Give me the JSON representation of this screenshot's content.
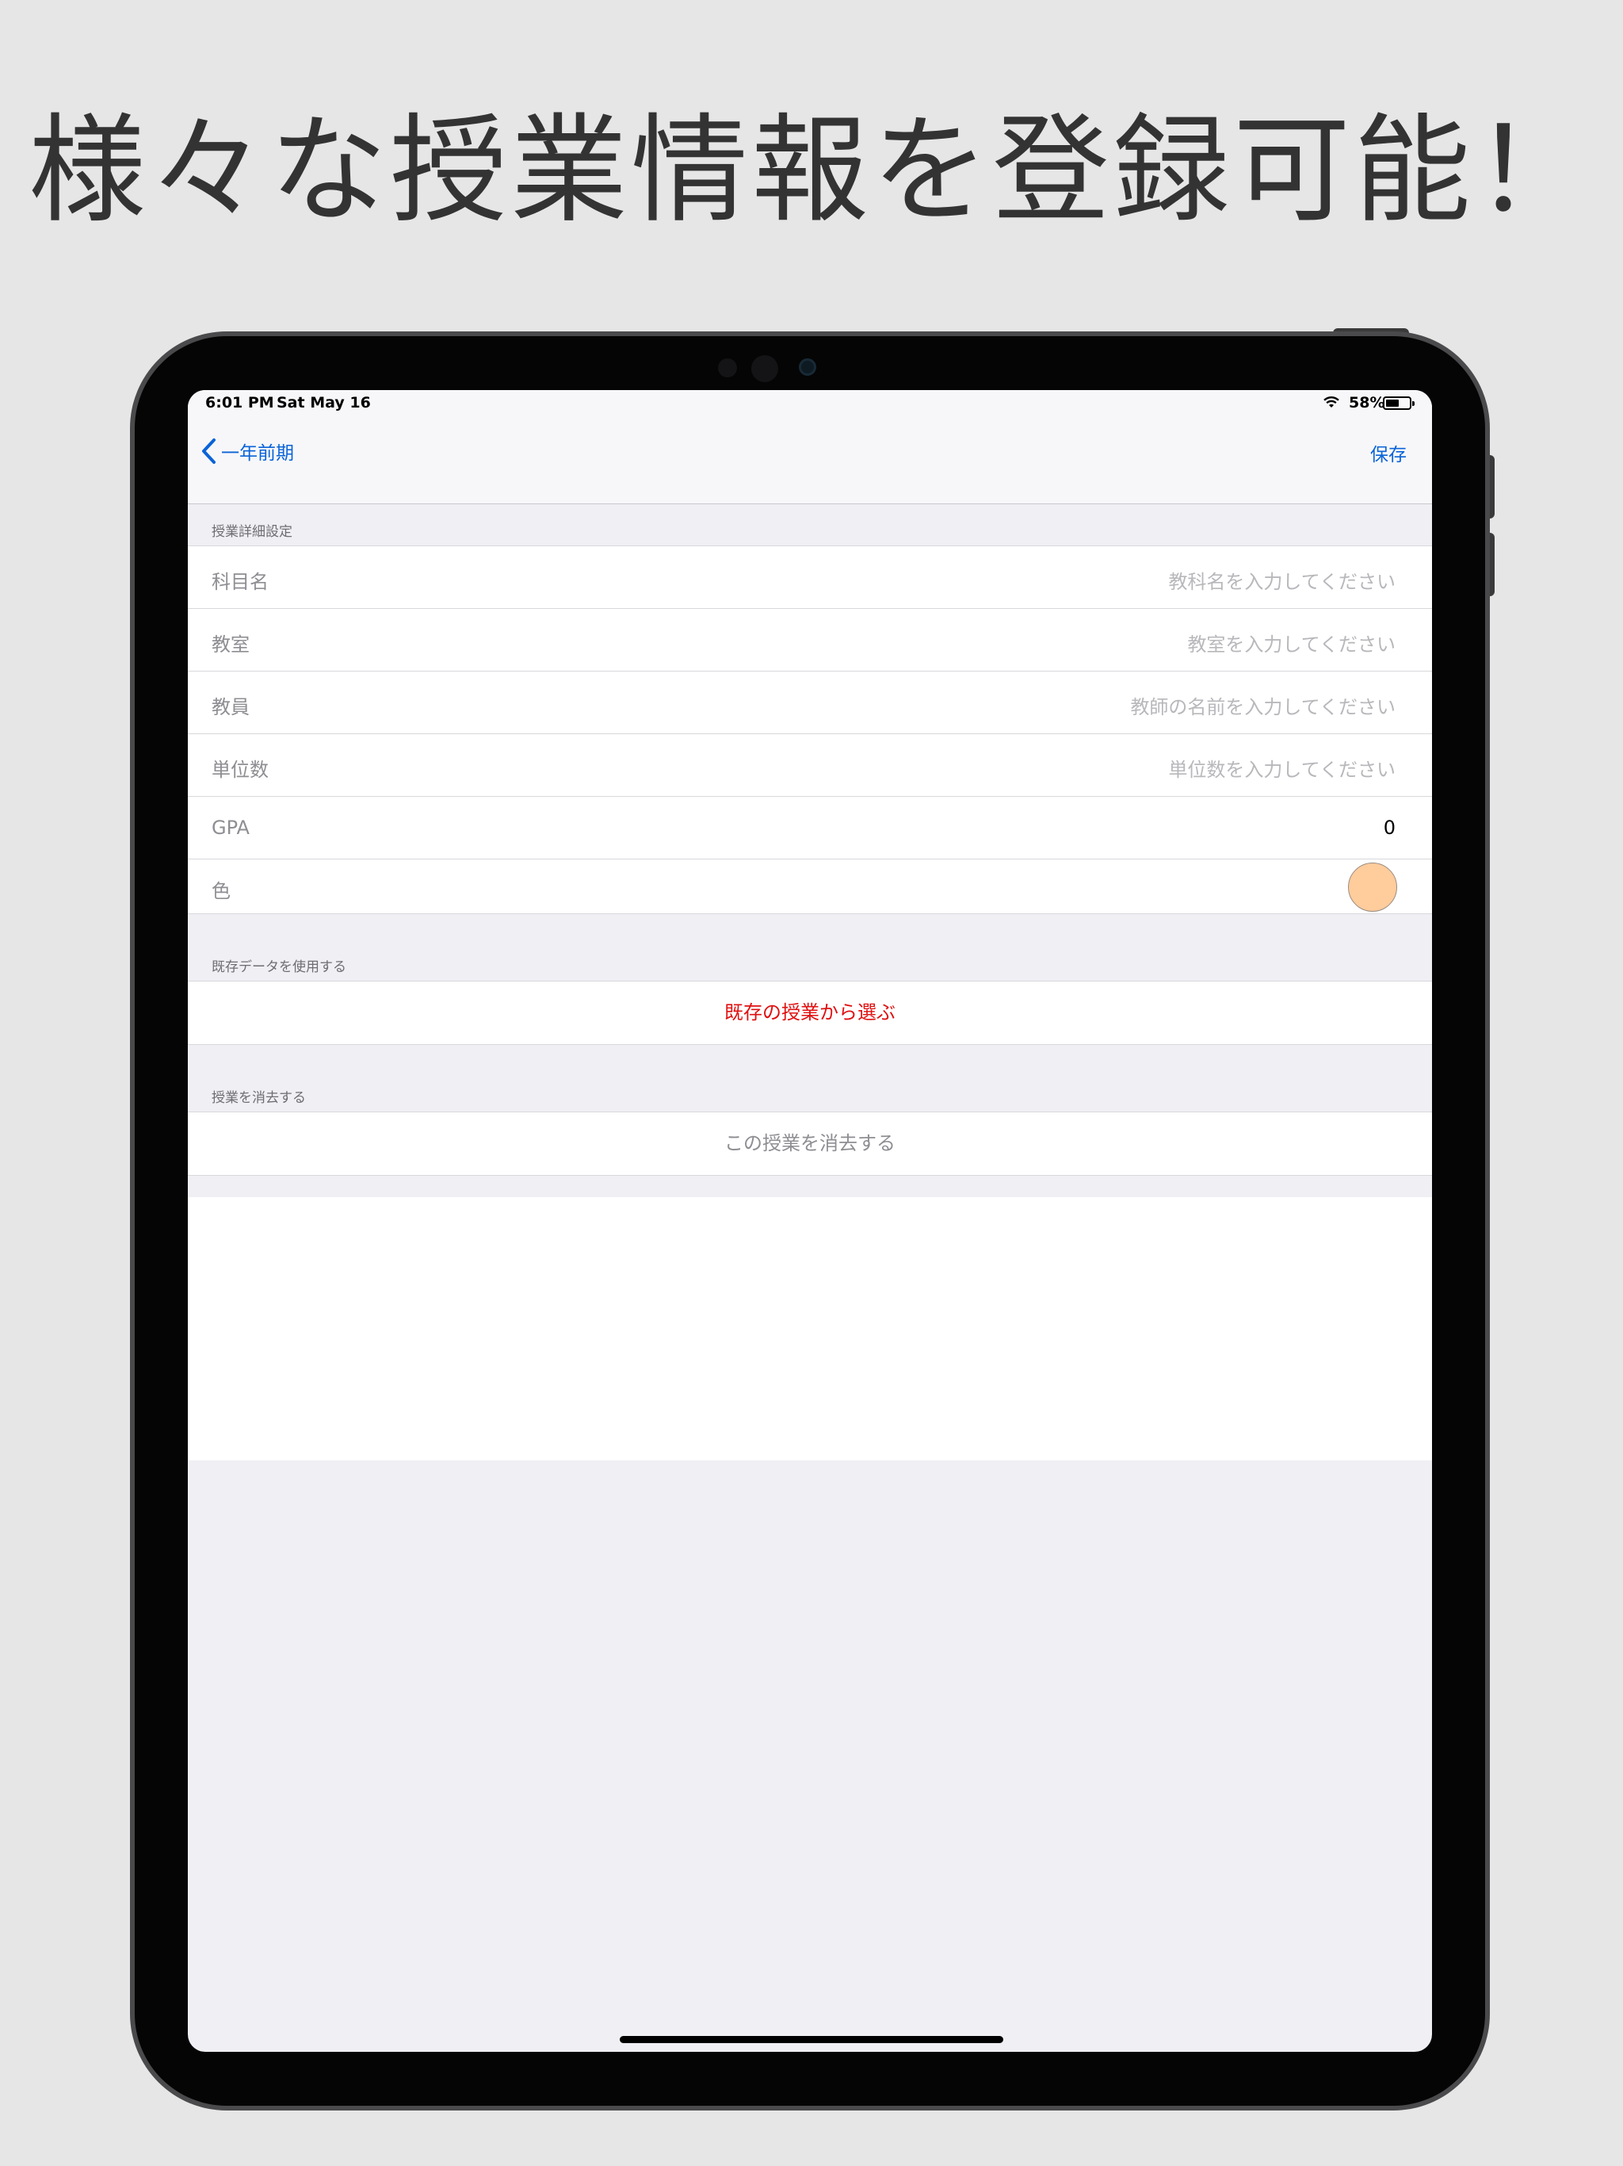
{
  "headline": "様々な授業情報を登録可能！",
  "status_bar": {
    "time": "6:01 PM",
    "date": "Sat May 16",
    "battery_percent": "58%",
    "battery_level": 0.58
  },
  "nav": {
    "back_label": "一年前期",
    "save_label": "保存"
  },
  "sections": {
    "details_header": "授業詳細設定",
    "existing_header": "既存データを使用する",
    "delete_header": "授業を消去する"
  },
  "fields": [
    {
      "label": "科目名",
      "placeholder": "教科名を入力してください"
    },
    {
      "label": "教室",
      "placeholder": "教室を入力してください"
    },
    {
      "label": "教員",
      "placeholder": "教師の名前を入力してください"
    },
    {
      "label": "単位数",
      "placeholder": "単位数を入力してください"
    },
    {
      "label": "GPA",
      "value": "0"
    },
    {
      "label": "色",
      "swatch_color": "#ffcc9c"
    }
  ],
  "actions": {
    "choose_existing": "既存の授業から選ぶ",
    "delete_class": "この授業を消去する"
  },
  "colors": {
    "accent": "#0a63d8",
    "destructive_red": "#e01010",
    "disabled_gray": "#8e8e93"
  }
}
